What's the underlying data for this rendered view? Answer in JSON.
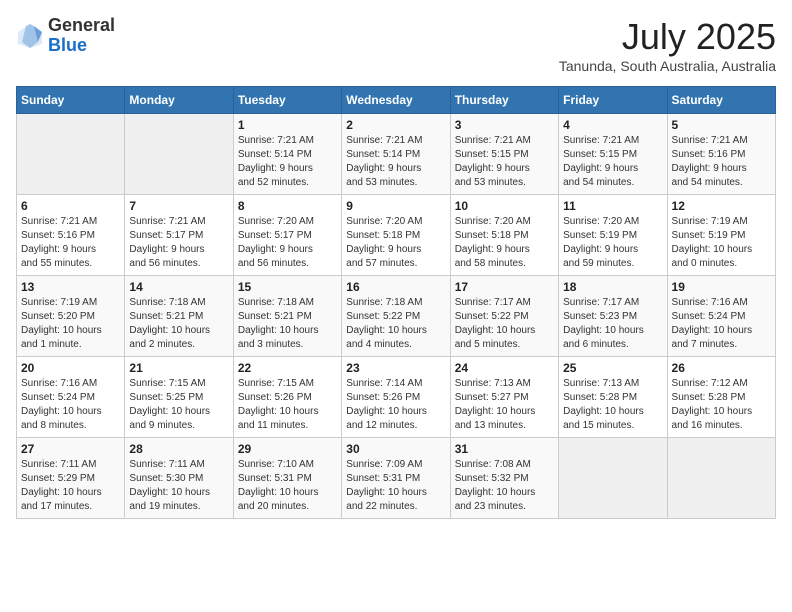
{
  "header": {
    "logo_general": "General",
    "logo_blue": "Blue",
    "month": "July 2025",
    "location": "Tanunda, South Australia, Australia"
  },
  "weekdays": [
    "Sunday",
    "Monday",
    "Tuesday",
    "Wednesday",
    "Thursday",
    "Friday",
    "Saturday"
  ],
  "weeks": [
    [
      {
        "day": "",
        "info": ""
      },
      {
        "day": "",
        "info": ""
      },
      {
        "day": "1",
        "info": "Sunrise: 7:21 AM\nSunset: 5:14 PM\nDaylight: 9 hours\nand 52 minutes."
      },
      {
        "day": "2",
        "info": "Sunrise: 7:21 AM\nSunset: 5:14 PM\nDaylight: 9 hours\nand 53 minutes."
      },
      {
        "day": "3",
        "info": "Sunrise: 7:21 AM\nSunset: 5:15 PM\nDaylight: 9 hours\nand 53 minutes."
      },
      {
        "day": "4",
        "info": "Sunrise: 7:21 AM\nSunset: 5:15 PM\nDaylight: 9 hours\nand 54 minutes."
      },
      {
        "day": "5",
        "info": "Sunrise: 7:21 AM\nSunset: 5:16 PM\nDaylight: 9 hours\nand 54 minutes."
      }
    ],
    [
      {
        "day": "6",
        "info": "Sunrise: 7:21 AM\nSunset: 5:16 PM\nDaylight: 9 hours\nand 55 minutes."
      },
      {
        "day": "7",
        "info": "Sunrise: 7:21 AM\nSunset: 5:17 PM\nDaylight: 9 hours\nand 56 minutes."
      },
      {
        "day": "8",
        "info": "Sunrise: 7:20 AM\nSunset: 5:17 PM\nDaylight: 9 hours\nand 56 minutes."
      },
      {
        "day": "9",
        "info": "Sunrise: 7:20 AM\nSunset: 5:18 PM\nDaylight: 9 hours\nand 57 minutes."
      },
      {
        "day": "10",
        "info": "Sunrise: 7:20 AM\nSunset: 5:18 PM\nDaylight: 9 hours\nand 58 minutes."
      },
      {
        "day": "11",
        "info": "Sunrise: 7:20 AM\nSunset: 5:19 PM\nDaylight: 9 hours\nand 59 minutes."
      },
      {
        "day": "12",
        "info": "Sunrise: 7:19 AM\nSunset: 5:19 PM\nDaylight: 10 hours\nand 0 minutes."
      }
    ],
    [
      {
        "day": "13",
        "info": "Sunrise: 7:19 AM\nSunset: 5:20 PM\nDaylight: 10 hours\nand 1 minute."
      },
      {
        "day": "14",
        "info": "Sunrise: 7:18 AM\nSunset: 5:21 PM\nDaylight: 10 hours\nand 2 minutes."
      },
      {
        "day": "15",
        "info": "Sunrise: 7:18 AM\nSunset: 5:21 PM\nDaylight: 10 hours\nand 3 minutes."
      },
      {
        "day": "16",
        "info": "Sunrise: 7:18 AM\nSunset: 5:22 PM\nDaylight: 10 hours\nand 4 minutes."
      },
      {
        "day": "17",
        "info": "Sunrise: 7:17 AM\nSunset: 5:22 PM\nDaylight: 10 hours\nand 5 minutes."
      },
      {
        "day": "18",
        "info": "Sunrise: 7:17 AM\nSunset: 5:23 PM\nDaylight: 10 hours\nand 6 minutes."
      },
      {
        "day": "19",
        "info": "Sunrise: 7:16 AM\nSunset: 5:24 PM\nDaylight: 10 hours\nand 7 minutes."
      }
    ],
    [
      {
        "day": "20",
        "info": "Sunrise: 7:16 AM\nSunset: 5:24 PM\nDaylight: 10 hours\nand 8 minutes."
      },
      {
        "day": "21",
        "info": "Sunrise: 7:15 AM\nSunset: 5:25 PM\nDaylight: 10 hours\nand 9 minutes."
      },
      {
        "day": "22",
        "info": "Sunrise: 7:15 AM\nSunset: 5:26 PM\nDaylight: 10 hours\nand 11 minutes."
      },
      {
        "day": "23",
        "info": "Sunrise: 7:14 AM\nSunset: 5:26 PM\nDaylight: 10 hours\nand 12 minutes."
      },
      {
        "day": "24",
        "info": "Sunrise: 7:13 AM\nSunset: 5:27 PM\nDaylight: 10 hours\nand 13 minutes."
      },
      {
        "day": "25",
        "info": "Sunrise: 7:13 AM\nSunset: 5:28 PM\nDaylight: 10 hours\nand 15 minutes."
      },
      {
        "day": "26",
        "info": "Sunrise: 7:12 AM\nSunset: 5:28 PM\nDaylight: 10 hours\nand 16 minutes."
      }
    ],
    [
      {
        "day": "27",
        "info": "Sunrise: 7:11 AM\nSunset: 5:29 PM\nDaylight: 10 hours\nand 17 minutes."
      },
      {
        "day": "28",
        "info": "Sunrise: 7:11 AM\nSunset: 5:30 PM\nDaylight: 10 hours\nand 19 minutes."
      },
      {
        "day": "29",
        "info": "Sunrise: 7:10 AM\nSunset: 5:31 PM\nDaylight: 10 hours\nand 20 minutes."
      },
      {
        "day": "30",
        "info": "Sunrise: 7:09 AM\nSunset: 5:31 PM\nDaylight: 10 hours\nand 22 minutes."
      },
      {
        "day": "31",
        "info": "Sunrise: 7:08 AM\nSunset: 5:32 PM\nDaylight: 10 hours\nand 23 minutes."
      },
      {
        "day": "",
        "info": ""
      },
      {
        "day": "",
        "info": ""
      }
    ]
  ]
}
